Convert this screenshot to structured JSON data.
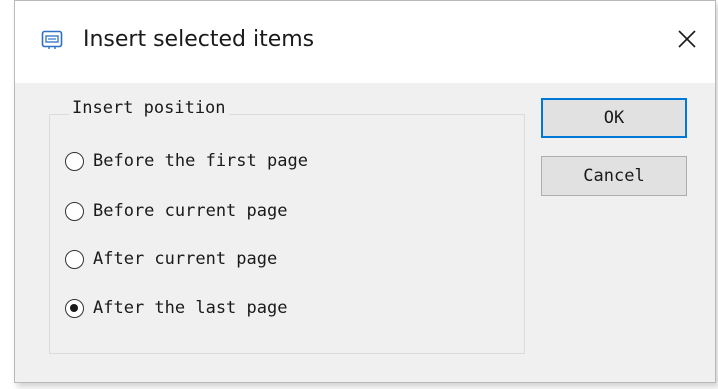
{
  "window": {
    "title": "Insert selected items",
    "icon": "insert-items-icon",
    "close_icon": "close-icon"
  },
  "group": {
    "legend": "Insert position",
    "options": [
      {
        "label": "Before the first page",
        "checked": false
      },
      {
        "label": "Before current page",
        "checked": false
      },
      {
        "label": "After current page",
        "checked": false
      },
      {
        "label": "After the last page",
        "checked": true
      }
    ]
  },
  "buttons": {
    "ok_label": "OK",
    "cancel_label": "Cancel"
  },
  "colors": {
    "accent": "#0078d7",
    "dialog_bg": "#f0f0f0",
    "titlebar_bg": "#ffffff",
    "icon_blue": "#2f6fc5"
  }
}
